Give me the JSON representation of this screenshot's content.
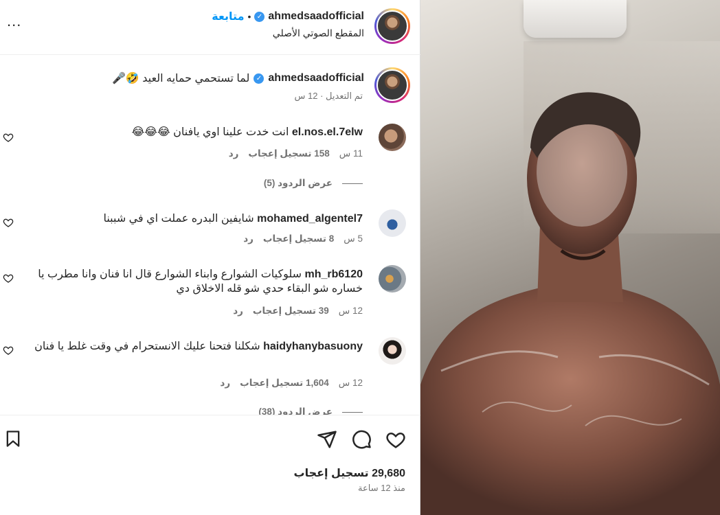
{
  "header": {
    "username": "ahmedsaadofficial",
    "follow_label": "متابعة",
    "dot": "•",
    "audio_label": "المقطع الصوتي الأصلي",
    "more_label": "..."
  },
  "caption": {
    "username": "ahmedsaadofficial",
    "text": "لما تستحمي حمايه العيد 🤣🎤",
    "meta": "تم التعديل · 12 س"
  },
  "comments": [
    {
      "username": "el.nos.el.7elw",
      "text": "انت خدت علينا اوي يافنان 😂😂😂",
      "time": "11 س",
      "likes": "158 تسجيل إعجاب",
      "reply": "رد",
      "view_replies": "عرض الردود (5)"
    },
    {
      "username": "mohamed_algentel7",
      "text": "شايفين البدره عملت اي في شببنا",
      "time": "5 س",
      "likes": "8 تسجيل إعجاب",
      "reply": "رد"
    },
    {
      "username": "mh_rb6120",
      "text": "سلوكيات الشوارع وابناء الشوارع قال انا فنان وانا مطرب يا خساره شو البقاء حدي شو قله الاخلاق دي",
      "time": "12 س",
      "likes": "39 تسجيل إعجاب",
      "reply": "رد"
    },
    {
      "username": "haidyhanybasuony",
      "text": "شكلنا فتحنا عليك الانستحرام في وقت غلط يا فنان",
      "time": "12 س",
      "likes": "1,604 تسجيل إعجاب",
      "reply": "رد",
      "view_replies": "عرض الردود (38)"
    }
  ],
  "footer": {
    "likes_total": "29,680 تسجيل إعجاب",
    "time_ago": "منذ 12 ساعة"
  },
  "icons": {
    "verified": "verified-badge-icon",
    "heart": "heart-icon",
    "comment": "comment-icon",
    "share": "share-icon",
    "save": "bookmark-icon",
    "more": "more-icon"
  },
  "colors": {
    "link": "#0095f6",
    "verified": "#3897f0",
    "muted": "#737373"
  }
}
